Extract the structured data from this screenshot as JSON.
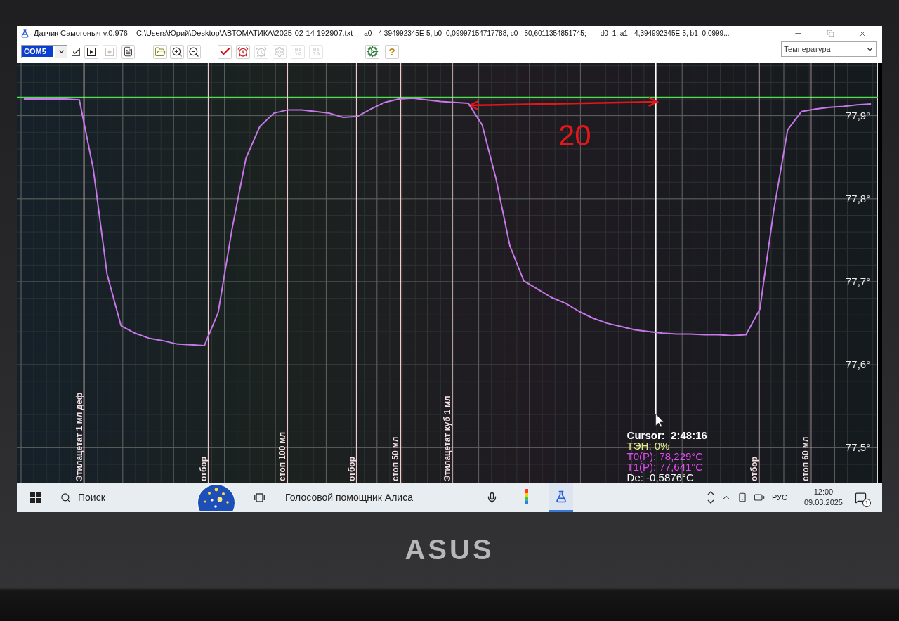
{
  "window": {
    "title": "Датчик Самогоныч v.0.976",
    "file_path": "C:\\Users\\Юрий\\Desktop\\АВТОМАТИКА\\2025-02-14 192907.txt",
    "coefficients": [
      "a0=-4,394992345E-5, b0=0,09997154717788, c0=-50,6011354851745;",
      "d0=1, a1=-4,394992345E-5, b1=0,0999..."
    ]
  },
  "toolbar": {
    "port": {
      "value": "COM5",
      "highlighted": true
    },
    "checkbox": {
      "checked": true
    },
    "button_groups": [
      [
        {
          "kind": "play",
          "disabled": false
        },
        {
          "kind": "record",
          "disabled": true
        },
        {
          "kind": "document",
          "disabled": false
        }
      ],
      [
        {
          "kind": "open",
          "disabled": false
        },
        {
          "kind": "zoom-in",
          "disabled": false
        },
        {
          "kind": "zoom-out",
          "disabled": false
        }
      ],
      [
        {
          "kind": "check",
          "disabled": false
        },
        {
          "kind": "alarm",
          "disabled": false
        },
        {
          "kind": "alarm",
          "disabled": true
        },
        {
          "kind": "settings",
          "disabled": true
        },
        {
          "kind": "digits",
          "disabled": true
        },
        {
          "kind": "digits",
          "disabled": true
        }
      ],
      [
        {
          "kind": "tools",
          "disabled": false
        },
        {
          "kind": "help",
          "label": "?",
          "disabled": false
        }
      ]
    ],
    "channel": {
      "value": "Температура"
    }
  },
  "chart": {
    "chart_data": {
      "type": "line",
      "grid": true,
      "categories": [
        null,
        null,
        null,
        null,
        null,
        null,
        null,
        null,
        null,
        null,
        null,
        null,
        null,
        null,
        null,
        null,
        null,
        null,
        null,
        null,
        null,
        null,
        null,
        null,
        null,
        null,
        null,
        null,
        null,
        null,
        null,
        null,
        null,
        null,
        null,
        null,
        null,
        null,
        null,
        null,
        null,
        null,
        null,
        null,
        null,
        null,
        null,
        null,
        null,
        null,
        null,
        null,
        null,
        null,
        null,
        null,
        null,
        null,
        null,
        null,
        null,
        null
      ],
      "ylim": [
        77.458,
        77.964
      ],
      "yticks": [
        {
          "value": 77.9,
          "label": "77,9°"
        },
        {
          "value": 77.8,
          "label": "77,8°"
        },
        {
          "value": 77.7,
          "label": "77,7°"
        },
        {
          "value": 77.6,
          "label": "77,6°"
        },
        {
          "value": 77.5,
          "label": "77,5°"
        }
      ],
      "series": [
        {
          "color": "#c678e8",
          "values": [
            77.92,
            77.92,
            77.92,
            77.92,
            77.919,
            77.836,
            77.709,
            77.647,
            77.638,
            77.632,
            77.629,
            77.625,
            77.624,
            77.623,
            77.663,
            77.764,
            77.849,
            77.887,
            77.903,
            77.907,
            77.907,
            77.905,
            77.903,
            77.898,
            77.899,
            77.908,
            77.916,
            77.92,
            77.921,
            77.919,
            77.917,
            77.916,
            77.915,
            77.889,
            77.824,
            77.743,
            77.701,
            77.691,
            77.681,
            77.674,
            77.664,
            77.656,
            77.65,
            77.646,
            77.642,
            77.64,
            77.638,
            77.637,
            77.637,
            77.636,
            77.636,
            77.635,
            77.636,
            77.667,
            77.786,
            77.883,
            77.905,
            77.908,
            77.91,
            77.911,
            77.913,
            77.914
          ]
        }
      ],
      "ref_lines": [
        {
          "axis": "y",
          "value": 77.922,
          "color": "#4ee04e"
        },
        {
          "axis": "x",
          "label": "Этилацетат 1 мл деф"
        },
        {
          "axis": "x",
          "label": "отбор"
        },
        {
          "axis": "x",
          "label": "стоп 100 мл"
        },
        {
          "axis": "x",
          "label": "отбор"
        },
        {
          "axis": "x",
          "label": "стоп 50 мл"
        },
        {
          "axis": "x",
          "label": "Этилацетат куб 1 мл"
        },
        {
          "axis": "x",
          "label": "отбор"
        },
        {
          "axis": "x",
          "label": "стоп 60 мл"
        },
        {
          "axis": "x"
        }
      ],
      "annotations": [
        "20"
      ]
    },
    "cursor_readout": [
      {
        "text": "Cursor:  2:48:16",
        "color": "#ffffff"
      },
      {
        "text": "ТЭН: 0%",
        "color": "#e6e98a"
      },
      {
        "text": "T0(P): 78,229°C",
        "color": "#e04cf0"
      },
      {
        "text": "T1(P): 77,641°C",
        "color": "#e04cf0"
      },
      {
        "text": "De: -0,5876°C",
        "color": "#ffffff"
      }
    ]
  },
  "taskbar": {
    "search_label": "Поиск",
    "assistant_text": "Голосовой помощник Алиса",
    "apps": [
      {
        "kind": "colored-bar",
        "active": false
      },
      {
        "kind": "flask",
        "active": true
      }
    ],
    "language": "РУС",
    "time": "12:00",
    "date": "09.03.2025",
    "notification_count": "1"
  },
  "laptop": {
    "logo": "ASUS"
  }
}
